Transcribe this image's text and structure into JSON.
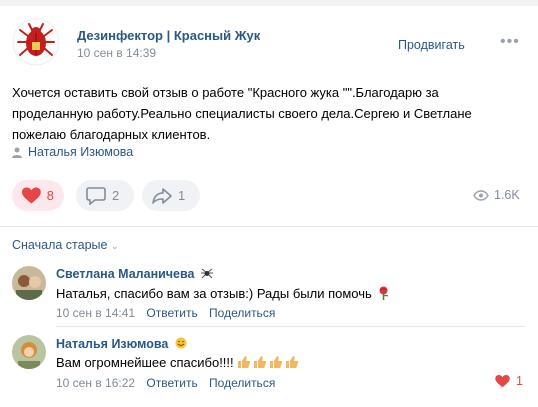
{
  "post": {
    "author": "Дезинфектор | Красный Жук",
    "date": "10 сен в 14:39",
    "promote_label": "Продвигать",
    "more_label": "•••",
    "text": "Хочется оставить свой отзыв о работе \"Красного жука \"\".Благодарю за проделанную работу.Реально специалисты своего дела.Сергею и Светлане пожелаю благодарных клиентов.",
    "signer": "Наталья Изюмова"
  },
  "actions": {
    "likes": "8",
    "comments": "2",
    "shares": "1",
    "views": "1.6K"
  },
  "comments_sort": "Сначала старые",
  "comments": [
    {
      "author": "Светлана Маланичева",
      "text": "Наталья, спасибо вам за отзыв:) Рады были помочь",
      "date": "10 сен в 14:41",
      "reply_label": "Ответить",
      "share_label": "Поделиться"
    },
    {
      "author": "Наталья Изюмова",
      "text": "Вам огромнейшее спасибо!!!!",
      "date": "10 сен в 16:22",
      "reply_label": "Ответить",
      "share_label": "Поделиться",
      "likes": "1"
    }
  ],
  "colors": {
    "link": "#2a5885",
    "muted": "#818c99",
    "like_red": "#e64646",
    "brand_red": "#c41e1e"
  }
}
